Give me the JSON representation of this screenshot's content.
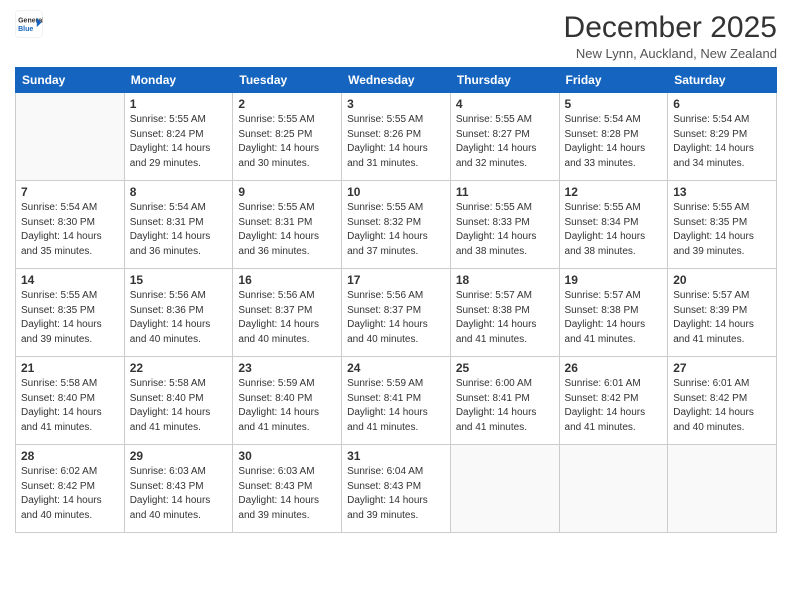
{
  "header": {
    "logo_line1": "General",
    "logo_line2": "Blue",
    "month": "December 2025",
    "location": "New Lynn, Auckland, New Zealand"
  },
  "weekdays": [
    "Sunday",
    "Monday",
    "Tuesday",
    "Wednesday",
    "Thursday",
    "Friday",
    "Saturday"
  ],
  "weeks": [
    [
      {
        "day": "",
        "empty": true
      },
      {
        "day": "1",
        "sunrise": "Sunrise: 5:55 AM",
        "sunset": "Sunset: 8:24 PM",
        "daylight": "Daylight: 14 hours and 29 minutes."
      },
      {
        "day": "2",
        "sunrise": "Sunrise: 5:55 AM",
        "sunset": "Sunset: 8:25 PM",
        "daylight": "Daylight: 14 hours and 30 minutes."
      },
      {
        "day": "3",
        "sunrise": "Sunrise: 5:55 AM",
        "sunset": "Sunset: 8:26 PM",
        "daylight": "Daylight: 14 hours and 31 minutes."
      },
      {
        "day": "4",
        "sunrise": "Sunrise: 5:55 AM",
        "sunset": "Sunset: 8:27 PM",
        "daylight": "Daylight: 14 hours and 32 minutes."
      },
      {
        "day": "5",
        "sunrise": "Sunrise: 5:54 AM",
        "sunset": "Sunset: 8:28 PM",
        "daylight": "Daylight: 14 hours and 33 minutes."
      },
      {
        "day": "6",
        "sunrise": "Sunrise: 5:54 AM",
        "sunset": "Sunset: 8:29 PM",
        "daylight": "Daylight: 14 hours and 34 minutes."
      }
    ],
    [
      {
        "day": "7",
        "sunrise": "Sunrise: 5:54 AM",
        "sunset": "Sunset: 8:30 PM",
        "daylight": "Daylight: 14 hours and 35 minutes."
      },
      {
        "day": "8",
        "sunrise": "Sunrise: 5:54 AM",
        "sunset": "Sunset: 8:31 PM",
        "daylight": "Daylight: 14 hours and 36 minutes."
      },
      {
        "day": "9",
        "sunrise": "Sunrise: 5:55 AM",
        "sunset": "Sunset: 8:31 PM",
        "daylight": "Daylight: 14 hours and 36 minutes."
      },
      {
        "day": "10",
        "sunrise": "Sunrise: 5:55 AM",
        "sunset": "Sunset: 8:32 PM",
        "daylight": "Daylight: 14 hours and 37 minutes."
      },
      {
        "day": "11",
        "sunrise": "Sunrise: 5:55 AM",
        "sunset": "Sunset: 8:33 PM",
        "daylight": "Daylight: 14 hours and 38 minutes."
      },
      {
        "day": "12",
        "sunrise": "Sunrise: 5:55 AM",
        "sunset": "Sunset: 8:34 PM",
        "daylight": "Daylight: 14 hours and 38 minutes."
      },
      {
        "day": "13",
        "sunrise": "Sunrise: 5:55 AM",
        "sunset": "Sunset: 8:35 PM",
        "daylight": "Daylight: 14 hours and 39 minutes."
      }
    ],
    [
      {
        "day": "14",
        "sunrise": "Sunrise: 5:55 AM",
        "sunset": "Sunset: 8:35 PM",
        "daylight": "Daylight: 14 hours and 39 minutes."
      },
      {
        "day": "15",
        "sunrise": "Sunrise: 5:56 AM",
        "sunset": "Sunset: 8:36 PM",
        "daylight": "Daylight: 14 hours and 40 minutes."
      },
      {
        "day": "16",
        "sunrise": "Sunrise: 5:56 AM",
        "sunset": "Sunset: 8:37 PM",
        "daylight": "Daylight: 14 hours and 40 minutes."
      },
      {
        "day": "17",
        "sunrise": "Sunrise: 5:56 AM",
        "sunset": "Sunset: 8:37 PM",
        "daylight": "Daylight: 14 hours and 40 minutes."
      },
      {
        "day": "18",
        "sunrise": "Sunrise: 5:57 AM",
        "sunset": "Sunset: 8:38 PM",
        "daylight": "Daylight: 14 hours and 41 minutes."
      },
      {
        "day": "19",
        "sunrise": "Sunrise: 5:57 AM",
        "sunset": "Sunset: 8:38 PM",
        "daylight": "Daylight: 14 hours and 41 minutes."
      },
      {
        "day": "20",
        "sunrise": "Sunrise: 5:57 AM",
        "sunset": "Sunset: 8:39 PM",
        "daylight": "Daylight: 14 hours and 41 minutes."
      }
    ],
    [
      {
        "day": "21",
        "sunrise": "Sunrise: 5:58 AM",
        "sunset": "Sunset: 8:40 PM",
        "daylight": "Daylight: 14 hours and 41 minutes."
      },
      {
        "day": "22",
        "sunrise": "Sunrise: 5:58 AM",
        "sunset": "Sunset: 8:40 PM",
        "daylight": "Daylight: 14 hours and 41 minutes."
      },
      {
        "day": "23",
        "sunrise": "Sunrise: 5:59 AM",
        "sunset": "Sunset: 8:40 PM",
        "daylight": "Daylight: 14 hours and 41 minutes."
      },
      {
        "day": "24",
        "sunrise": "Sunrise: 5:59 AM",
        "sunset": "Sunset: 8:41 PM",
        "daylight": "Daylight: 14 hours and 41 minutes."
      },
      {
        "day": "25",
        "sunrise": "Sunrise: 6:00 AM",
        "sunset": "Sunset: 8:41 PM",
        "daylight": "Daylight: 14 hours and 41 minutes."
      },
      {
        "day": "26",
        "sunrise": "Sunrise: 6:01 AM",
        "sunset": "Sunset: 8:42 PM",
        "daylight": "Daylight: 14 hours and 41 minutes."
      },
      {
        "day": "27",
        "sunrise": "Sunrise: 6:01 AM",
        "sunset": "Sunset: 8:42 PM",
        "daylight": "Daylight: 14 hours and 40 minutes."
      }
    ],
    [
      {
        "day": "28",
        "sunrise": "Sunrise: 6:02 AM",
        "sunset": "Sunset: 8:42 PM",
        "daylight": "Daylight: 14 hours and 40 minutes."
      },
      {
        "day": "29",
        "sunrise": "Sunrise: 6:03 AM",
        "sunset": "Sunset: 8:43 PM",
        "daylight": "Daylight: 14 hours and 40 minutes."
      },
      {
        "day": "30",
        "sunrise": "Sunrise: 6:03 AM",
        "sunset": "Sunset: 8:43 PM",
        "daylight": "Daylight: 14 hours and 39 minutes."
      },
      {
        "day": "31",
        "sunrise": "Sunrise: 6:04 AM",
        "sunset": "Sunset: 8:43 PM",
        "daylight": "Daylight: 14 hours and 39 minutes."
      },
      {
        "day": "",
        "empty": true
      },
      {
        "day": "",
        "empty": true
      },
      {
        "day": "",
        "empty": true
      }
    ]
  ]
}
